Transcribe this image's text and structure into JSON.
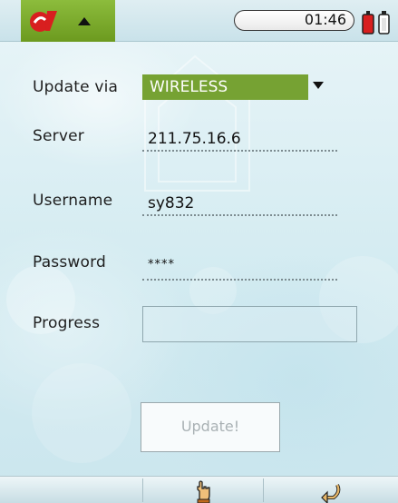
{
  "status_bar": {
    "time": "01:46",
    "icons": [
      "app-logo-icon",
      "up-arrow-icon",
      "battery-icon"
    ]
  },
  "form": {
    "update_via": {
      "label": "Update via",
      "value": "WIRELESS"
    },
    "server": {
      "label": "Server",
      "value": "211.75.16.6"
    },
    "username": {
      "label": "Username",
      "value": "sy832"
    },
    "password": {
      "label": "Password",
      "value": "****"
    },
    "progress": {
      "label": "Progress",
      "value": 0
    }
  },
  "actions": {
    "update_label": "Update!"
  },
  "bottom_bar": {
    "icons": [
      "hand-pointer-icon",
      "back-arrow-icon"
    ]
  },
  "colors": {
    "accent_green": "#76a233",
    "background": "#d8ecf2"
  }
}
